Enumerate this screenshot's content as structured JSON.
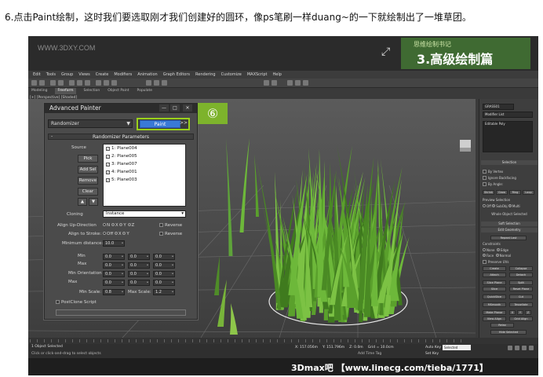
{
  "caption": "6.点击Paint绘制，这时我们要选取刚才我们创建好的圆环，像ps笔刷一样duang~的一下就绘制出了一堆草团。",
  "banner": {
    "watermark": "WWW.3DXY.COM",
    "logo_small": "思维绘制书记",
    "title": "3.高级绘制篇"
  },
  "menubar": [
    "Edit",
    "Tools",
    "Group",
    "Views",
    "Create",
    "Modifiers",
    "Animation",
    "Graph Editors",
    "Rendering",
    "Customize",
    "MAXScript",
    "Help"
  ],
  "ribbon": [
    "Modeling",
    "Freeform",
    "Selection",
    "Object Paint",
    "Populate"
  ],
  "viewport": {
    "label": "[+] [Perspective] [Shaded]"
  },
  "dialog": {
    "title": "Advanced Painter",
    "mode_select": "Randomizer",
    "paint_button": "Paint",
    "more_button": ">>",
    "rollout_title": "Randomizer Parameters",
    "rollout_toggle": "-",
    "source_label": "Source",
    "buttons": {
      "pick": "Pick",
      "add_sel": "Add Sel",
      "remove": "Remove",
      "clear": "Clear"
    },
    "sources": [
      "1: Plane004",
      "2: Plane005",
      "3: Plane007",
      "4: Plane001",
      "5: Plane003"
    ],
    "cloning_label": "Cloning",
    "cloning_value": "Instance",
    "align_up_label": "Align Up-Direction",
    "align_up_opts": [
      "N",
      "X",
      "Y",
      "Z"
    ],
    "align_stroke_label": "Align to Stroke:",
    "align_stroke_opts": [
      "Off",
      "X",
      "Y"
    ],
    "reverse_label": "Reverse",
    "min_distance_label": "Minimum distance:",
    "min_distance_value": "10.0",
    "min_label": "Min",
    "max_label": "Max",
    "min_orient_label": "Min Orientation",
    "max_orient_label": "Max",
    "min_values": [
      "0.0",
      "0.0",
      "0.0"
    ],
    "max_values": [
      "0.0",
      "0.0",
      "0.0"
    ],
    "min_orient_values": [
      "0.0",
      "0.0",
      "0.0"
    ],
    "max_orient_values": [
      "0.0",
      "0.0",
      "0.0"
    ],
    "min_scale_label": "Min Scale:",
    "min_scale_value": "0.8",
    "max_scale_label": "Max Scale:",
    "max_scale_value": "1.2",
    "postclone_label": "PostClone Script"
  },
  "step_badge": "⑥",
  "cmdpanel": {
    "object_name": "GRASS01",
    "modifier_list": "Modifier List",
    "stack_item": "Editable Poly",
    "selection_header": "Selection",
    "opt1": "By Vertex",
    "opt2": "Ignore Backfacing",
    "opt3": "By Angle:",
    "opt4": "Shrink",
    "opt5": "Grow",
    "opt6": "Ring",
    "opt7": "Loop",
    "preview_label": "Preview Selection",
    "preview_opts": [
      "Off",
      "SubObj",
      "Multi"
    ],
    "whole_object": "Whole Object Selected",
    "soft_selection": "Soft Selection",
    "edit_geometry": "Edit Geometry",
    "repeat_last": "Repeat Last",
    "constraints": "Constraints",
    "constraint_opts": [
      "None",
      "Edge",
      "Face",
      "Normal"
    ],
    "preserve_uvs": "Preserve UVs",
    "create": "Create",
    "collapse": "Collapse",
    "attach": "Attach",
    "detach": "Detach",
    "slice_plane": "Slice Plane",
    "split": "Split",
    "slice": "Slice",
    "reset_plane": "Reset Plane",
    "quickslice": "QuickSlice",
    "cut": "Cut",
    "msmooth": "MSmooth",
    "tessellate": "Tessellate",
    "make_planar": "Make Planar",
    "xyz": [
      "X",
      "Y",
      "Z"
    ],
    "view_align": "View Align",
    "grid_align": "Grid Align",
    "relax": "Relax",
    "hide_selected": "Hide Selected"
  },
  "status": {
    "line1": "1 Object Selected",
    "line2": "Click or click-and-drag to select objects",
    "x": "X: 157.056m",
    "y": "Y: 151.796m",
    "z": "Z: 0.0m",
    "grid": "Grid = 10.0cm",
    "add_time_tag": "Add Time Tag",
    "auto_key": "Auto Key",
    "set_key": "Set Key",
    "selected": "Selected"
  },
  "footer": {
    "brand": "3Dmax吧 【www.linecg.com/tieba/1771】"
  },
  "colors": {
    "accent_green": "#7db32c",
    "paint_blue": "#3979d6",
    "grass": "#5aa02c"
  }
}
